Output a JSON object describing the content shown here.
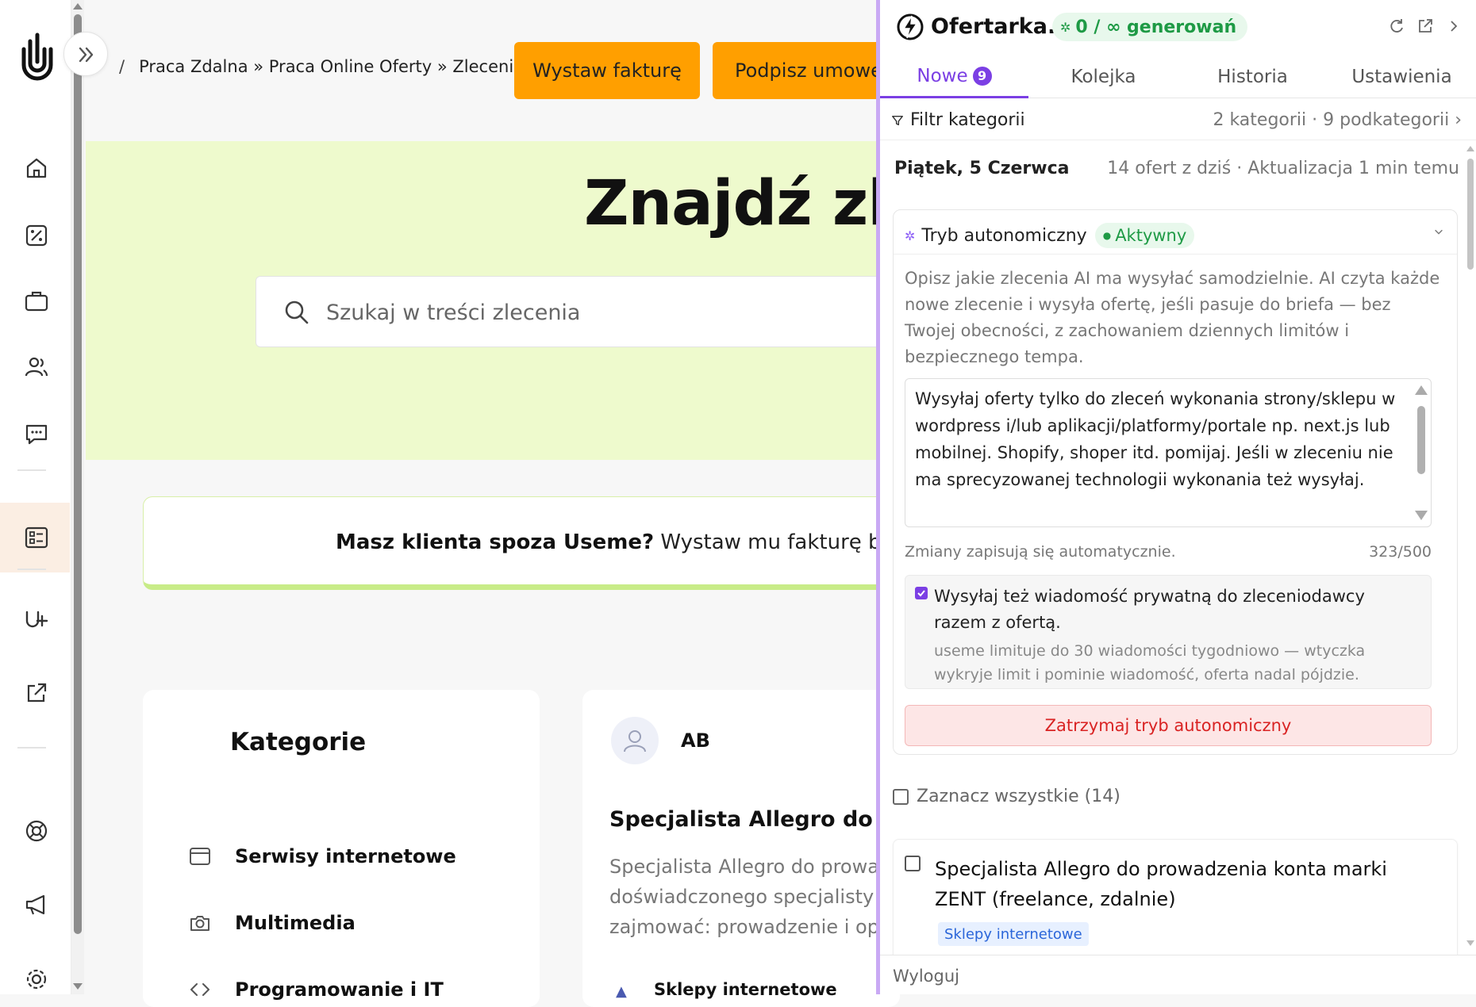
{
  "rail": {
    "items": [
      "home-icon",
      "percent-icon",
      "briefcase-icon",
      "users-icon",
      "chat-icon",
      "orders-icon",
      "usemeplus-icon",
      "external-link-icon",
      "help-icon",
      "megaphone-icon",
      "settings-icon"
    ]
  },
  "breadcrumb": {
    "separator": "/",
    "text": "Praca Zdalna » Praca Online Oferty » Zleceni..."
  },
  "header": {
    "invoice_button": "Wystaw fakturę",
    "contract_button": "Podpisz umowę"
  },
  "hero": {
    "title": "Znajdź zlece",
    "search_placeholder": "Szukaj w treści zlecenia"
  },
  "promo": {
    "bold": "Masz klienta spoza Useme?",
    "rest": " Wystaw mu fakturę bez fi"
  },
  "categories": {
    "title": "Kategorie",
    "items": [
      "Serwisy internetowe",
      "Multimedia",
      "Programowanie i IT"
    ]
  },
  "job": {
    "initials": "AB",
    "title": "Specjalista Allegro do prow",
    "description": "Specjalista Allegro do prowadz doświadczonego specjalisty Al zajmować: prowadzenie i opty",
    "tag": "Sklepy internetowe"
  },
  "extension": {
    "brand": "Ofertarka.pl",
    "generation_counter": "0 / ∞ generowań",
    "tabs": [
      {
        "label": "Nowe",
        "badge": "9"
      },
      {
        "label": "Kolejka"
      },
      {
        "label": "Historia"
      },
      {
        "label": "Ustawienia"
      }
    ],
    "filter": {
      "label": "Filtr kategorii",
      "value": "2 kategorii · 9 podkategorii"
    },
    "date": {
      "day": "Piątek, 5 Czerwca",
      "summary": "14 ofert z dziś · Aktualizacja 1 min temu"
    },
    "autonomous": {
      "title": "Tryb autonomiczny",
      "status": "Aktywny",
      "description": "Opisz jakie zlecenia AI ma wysyłać samodzielnie. AI czyta każde nowe zlecenie i wysyła ofertę, jeśli pasuje do briefa — bez Twojej obecności, z zachowaniem dziennych limitów i bezpiecznego tempa.",
      "brief": "Wysyłaj oferty tylko do zleceń wykonania strony/sklepu w wordpress i/lub aplikacji/platformy/portale np. next.js lub mobilnej. Shopify, shoper itd. pomijaj. Jeśli w zleceniu nie ma sprecyzowanej technologii wykonania też wysyłaj.",
      "autosave_note": "Zmiany zapisują się automatycznie.",
      "char_count": "323/500",
      "private_message_label": "Wysyłaj też wiadomość prywatną do zleceniodawcy razem z ofertą.",
      "private_message_note": "useme limituje do 30 wiadomości tygodniowo — wtyczka wykryje limit i pominie wiadomość, oferta nadal pójdzie.",
      "stop_button": "Zatrzymaj tryb autonomiczny"
    },
    "select_all": "Zaznacz wszystkie (14)",
    "offers": [
      {
        "title": "Specjalista Allegro do prowadzenia konta marki ZENT (freelance, zdalnie)",
        "tag": "Sklepy internetowe"
      }
    ],
    "logout": "Wyloguj",
    "colors": {
      "accent": "#7b3fe4",
      "success": "#1e9a45",
      "danger": "#d92323",
      "cta": "#ff9f00"
    }
  }
}
